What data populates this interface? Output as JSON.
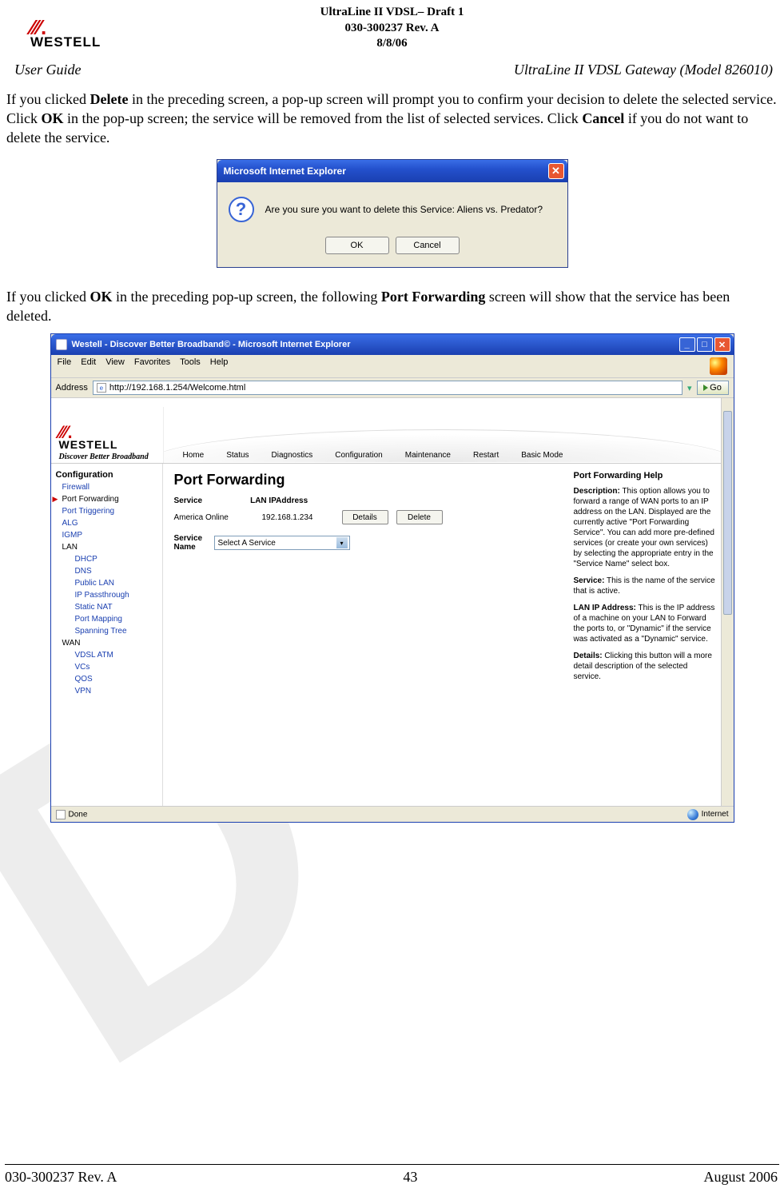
{
  "header": {
    "line1": "UltraLine II VDSL– Draft 1",
    "line2": "030-300237 Rev. A",
    "line3": "8/8/06"
  },
  "logo_text": "WESTELL",
  "subheader": {
    "left": "User Guide",
    "right": "UltraLine II VDSL Gateway (Model 826010)"
  },
  "para1": {
    "t1": "If you clicked ",
    "b1": "Delete",
    "t2": " in the preceding screen, a pop-up screen will prompt you to confirm your decision to delete the selected service. Click ",
    "b2": "OK",
    "t3": " in the pop-up screen; the service will be removed from the list of selected services. Click ",
    "b3": "Cancel",
    "t4": " if you do not want to delete the service."
  },
  "dialog": {
    "title": "Microsoft Internet Explorer",
    "message": "Are you sure you want to delete this Service: Aliens vs. Predator?",
    "ok": "OK",
    "cancel": "Cancel"
  },
  "para2": {
    "t1": "If you clicked ",
    "b1": "OK",
    "t2": " in the preceding pop-up screen, the following ",
    "b2": "Port Forwarding",
    "t3": " screen will show that the service has been deleted."
  },
  "browser": {
    "title": "Westell - Discover Better Broadband© - Microsoft Internet Explorer",
    "menu": [
      "File",
      "Edit",
      "View",
      "Favorites",
      "Tools",
      "Help"
    ],
    "addr_label": "Address",
    "addr_url": "http://192.168.1.254/Welcome.html",
    "go": "Go",
    "status_left": "Done",
    "status_right": "Internet"
  },
  "westell": {
    "tag": "Discover Better Broadband",
    "nav": [
      "Home",
      "Status",
      "Diagnostics",
      "Configuration",
      "Maintenance",
      "Restart",
      "Basic Mode"
    ],
    "side_header": "Configuration",
    "side_items": [
      "Firewall",
      "Port Forwarding",
      "Port Triggering",
      "ALG",
      "IGMP"
    ],
    "side_lan": "LAN",
    "lan_items": [
      "DHCP",
      "DNS",
      "Public LAN",
      "IP Passthrough",
      "Static NAT",
      "Port Mapping",
      "Spanning Tree"
    ],
    "side_wan": "WAN",
    "wan_items": [
      "VDSL ATM",
      "VCs",
      "QOS",
      "VPN"
    ],
    "pf_title": "Port Forwarding",
    "th_service": "Service",
    "th_ip": "LAN IPAddress",
    "row_service": "America Online",
    "row_ip": "192.168.1.234",
    "btn_details": "Details",
    "btn_delete": "Delete",
    "svc_label": "Service Name",
    "svc_select": "Select A Service",
    "help_title": "Port Forwarding Help",
    "help_desc_h": "Description:",
    "help_desc": " This option allows you to forward a range of WAN ports to an IP address on the LAN. Displayed are the currently active \"Port Forwarding Service\". You can add more pre-defined services (or create your own services) by selecting the appropriate entry in the \"Service Name\" select box.",
    "help_svc_h": "Service:",
    "help_svc": " This is the name of the service that is active.",
    "help_ip_h": "LAN IP Address:",
    "help_ip": " This is the IP address of a machine on your LAN to Forward the ports to, or \"Dynamic\" if the service was activated as a \"Dynamic\" service.",
    "help_det_h": "Details:",
    "help_det": " Clicking this button will a more detail description of the selected service."
  },
  "footer": {
    "left": "030-300237 Rev. A",
    "center": "43",
    "right": "August 2006"
  }
}
